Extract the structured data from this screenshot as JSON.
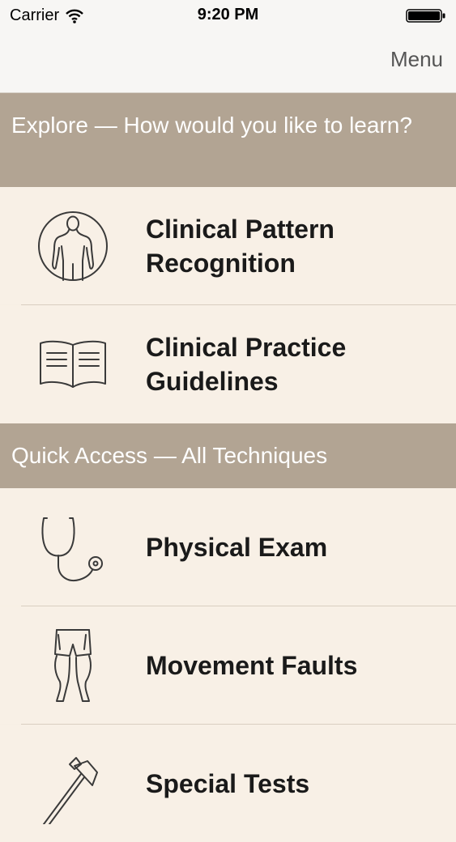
{
  "status_bar": {
    "carrier": "Carrier",
    "time": "9:20 PM"
  },
  "nav": {
    "menu_label": "Menu"
  },
  "sections": {
    "explore": {
      "header": "Explore — How would you like to learn?",
      "items": [
        {
          "label": "Clinical Pattern Recognition",
          "icon": "body-circle-icon"
        },
        {
          "label": "Clinical Practice Guidelines",
          "icon": "book-icon"
        }
      ]
    },
    "quick_access": {
      "header": "Quick Access — All Techniques",
      "items": [
        {
          "label": "Physical Exam",
          "icon": "stethoscope-icon"
        },
        {
          "label": "Movement Faults",
          "icon": "legs-icon"
        },
        {
          "label": "Special Tests",
          "icon": "reflex-hammer-icon"
        }
      ]
    }
  },
  "colors": {
    "section_header_bg": "#b2a493",
    "list_bg": "#f8f0e6",
    "nav_bg": "#f7f6f4",
    "icon_stroke": "#3a3a3a"
  }
}
